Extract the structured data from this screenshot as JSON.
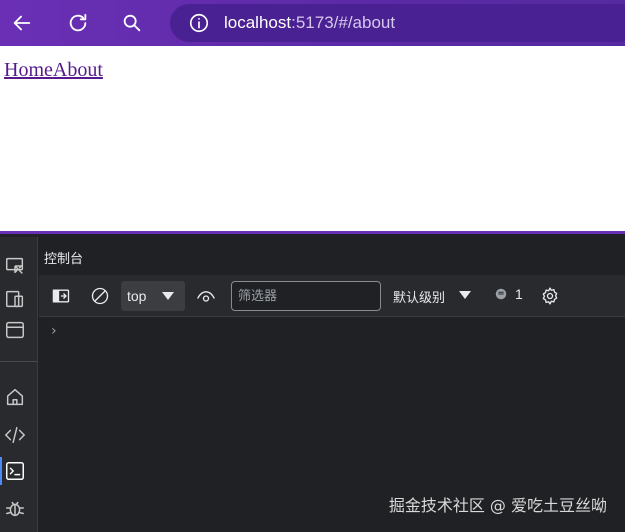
{
  "browser": {
    "url_host": "localhost",
    "url_rest": ":5173/#/about"
  },
  "page": {
    "links": [
      "Home",
      "About"
    ]
  },
  "devtools": {
    "panel_title": "控制台",
    "context": "top",
    "filter_placeholder": "筛选器",
    "levels_label": "默认级别",
    "issues_count": "1",
    "prompt": "›"
  },
  "watermark": "掘金技术社区 @ 爱吃土豆丝呦",
  "colors": {
    "topbar": "#6a2fb5",
    "urlbar": "#4a2192",
    "link": "#551a8b",
    "devtools_bg": "#202124",
    "toolbar_bg": "#292a2d",
    "active_accent": "#4a8cf7"
  },
  "icons": {
    "back": "arrow-left-icon",
    "reload": "reload-icon",
    "search": "search-icon",
    "site_info": "info-icon"
  }
}
